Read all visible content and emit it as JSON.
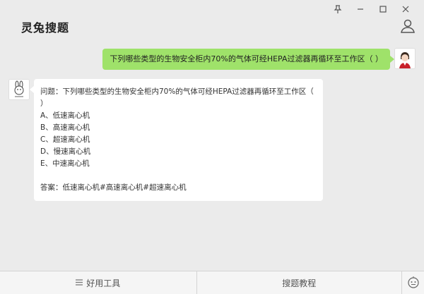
{
  "app": {
    "title": "灵兔搜题"
  },
  "window_controls": [
    "pin-icon",
    "minimize-icon",
    "maximize-icon",
    "close-icon"
  ],
  "user_message": {
    "text": "下列哪些类型的生物安全柜内70%的气体可经HEPA过滤器再循环至工作区（ ）"
  },
  "bot_message": {
    "lines": [
      "问题：下列哪些类型的生物安全柜内70%的气体可经HEPA过滤器再循环至工作区（",
      "）",
      "A、低速离心机",
      "B、高速离心机",
      "C、超速离心机",
      "D、慢速离心机",
      "E、中速离心机"
    ],
    "answer": "答案：低速离心机#高速离心机#超速离心机"
  },
  "bottom": {
    "tools_label": "好用工具",
    "tutorial_label": "搜题教程"
  },
  "colors": {
    "user_bubble": "#9fe26a",
    "background": "#ebebeb"
  }
}
